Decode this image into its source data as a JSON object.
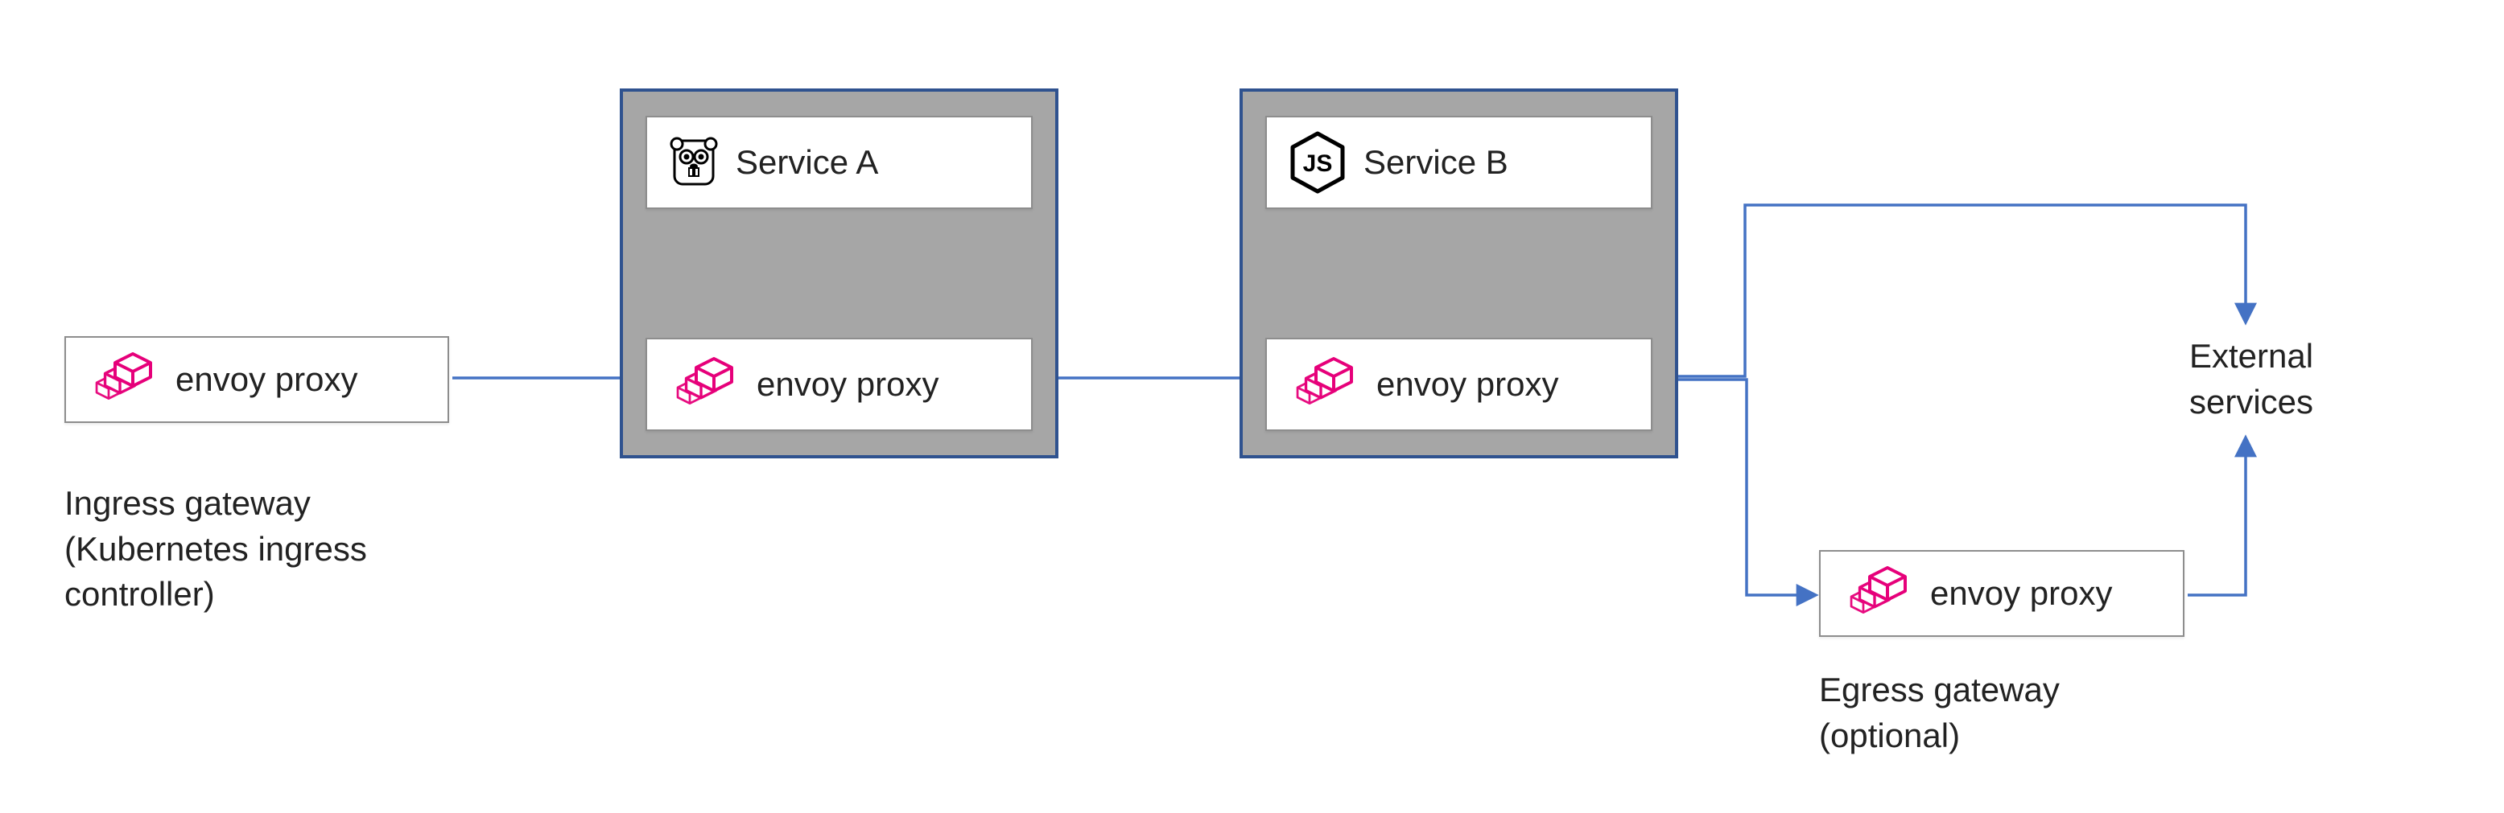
{
  "nodes": {
    "ingress_proxy": {
      "label": "envoy proxy",
      "icon": "envoy"
    },
    "service_a": {
      "label": "Service A",
      "icon": "gopher"
    },
    "service_a_proxy": {
      "label": "envoy proxy",
      "icon": "envoy"
    },
    "service_b": {
      "label": "Service B",
      "icon": "nodejs"
    },
    "service_b_proxy": {
      "label": "envoy proxy",
      "icon": "envoy"
    },
    "egress_proxy": {
      "label": "envoy proxy",
      "icon": "envoy"
    }
  },
  "captions": {
    "ingress": "Ingress gateway\n(Kubernetes ingress\ncontroller)",
    "egress": "Egress gateway\n(optional)",
    "external": "External\nservices"
  },
  "edges": [
    {
      "from": "ingress_proxy",
      "to": "service_a_proxy",
      "kind": "uni"
    },
    {
      "from": "service_a",
      "to": "service_a_proxy",
      "kind": "bi"
    },
    {
      "from": "service_a_proxy",
      "to": "service_b_proxy",
      "kind": "uni"
    },
    {
      "from": "service_b",
      "to": "service_b_proxy",
      "kind": "bi"
    },
    {
      "from": "service_b_proxy",
      "to": "external",
      "kind": "uni"
    },
    {
      "from": "service_b_proxy",
      "to": "egress_proxy",
      "kind": "uni"
    },
    {
      "from": "egress_proxy",
      "to": "external",
      "kind": "uni"
    }
  ],
  "colors": {
    "arrow": "#4472C4",
    "container_fill": "#A6A6A6",
    "container_border": "#2F528F",
    "envoy_pink": "#E6007A"
  }
}
